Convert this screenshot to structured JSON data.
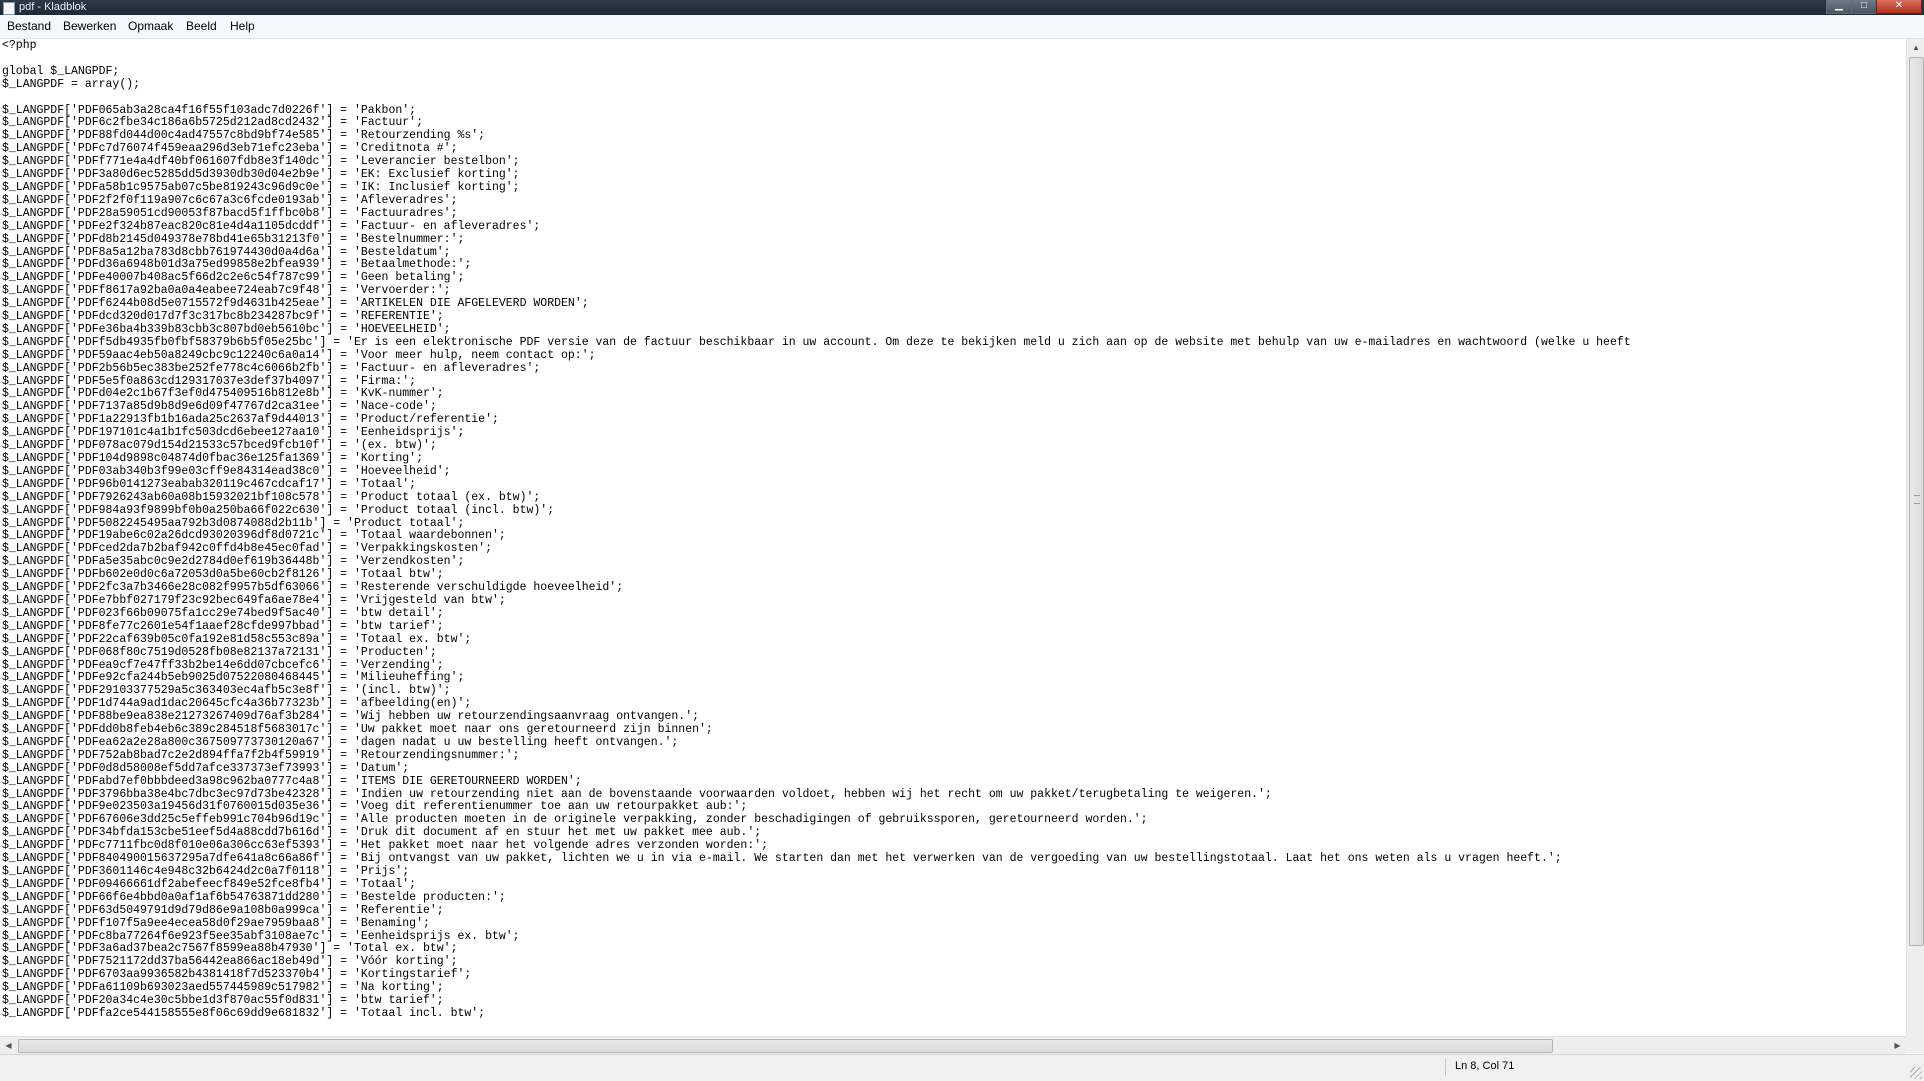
{
  "window": {
    "title": "pdf - Kladblok",
    "buttons": {
      "minimize": "▁",
      "maximize": "□",
      "close": "✕"
    }
  },
  "menu": [
    "Bestand",
    "Bewerken",
    "Opmaak",
    "Beeld",
    "Help"
  ],
  "editor": {
    "lines": [
      "<?php",
      "",
      "global $_LANGPDF;",
      "$_LANGPDF = array();",
      "",
      "$_LANGPDF['PDF065ab3a28ca4f16f55f103adc7d0226f'] = 'Pakbon';",
      "$_LANGPDF['PDF6c2fbe34c186a6b5725d212ad8cd2432'] = 'Factuur';",
      "$_LANGPDF['PDF88fd044d00c4ad47557c8bd9bf74e585'] = 'Retourzending %s';",
      "$_LANGPDF['PDFc7d76074f459eaa296d3eb71efc23eba'] = 'Creditnota #';",
      "$_LANGPDF['PDFf771e4a4df40bf061607fdb8e3f140dc'] = 'Leverancier bestelbon';",
      "$_LANGPDF['PDF3a80d6ec5285dd5d3930db30d04e2b9e'] = 'EK: Exclusief korting';",
      "$_LANGPDF['PDFa58b1c9575ab07c5be819243c96d9c0e'] = 'IK: Inclusief korting';",
      "$_LANGPDF['PDF2f2f0f119a907c6c67a3c6fcde0193ab'] = 'Afleveradres';",
      "$_LANGPDF['PDF28a59051cd90053f87bacd5f1ffbc0b8'] = 'Factuuradres';",
      "$_LANGPDF['PDFe2f324b87eac820c81e4d4a1105dcddf'] = 'Factuur- en afleveradres';",
      "$_LANGPDF['PDFd8b2145d049378e78bd41e65b31213f0'] = 'Bestelnummer:';",
      "$_LANGPDF['PDF8a5a12ba783d8cbb761974430d0a4d6a'] = 'Besteldatum';",
      "$_LANGPDF['PDFd36a6948b01d3a75ed99858e2bfea939'] = 'Betaalmethode:';",
      "$_LANGPDF['PDFe40007b408ac5f66d2c2e6c54f787c99'] = 'Geen betaling';",
      "$_LANGPDF['PDFf8617a92ba0a0a4eabee724eab7c9f48'] = 'Vervoerder:';",
      "$_LANGPDF['PDFf6244b08d5e0715572f9d4631b425eae'] = 'ARTIKELEN DIE AFGELEVERD WORDEN';",
      "$_LANGPDF['PDFdcd320d017d7f3c317bc8b234287bc9f'] = 'REFERENTIE';",
      "$_LANGPDF['PDFe36ba4b339b83cbb3c807bd0eb5610bc'] = 'HOEVEELHEID';",
      "$_LANGPDF['PDFf5db4935fb0fbf58379b6b5f05e25bc'] = 'Er is een elektronische PDF versie van de factuur beschikbaar in uw account. Om deze te bekijken meld u zich aan op de website met behulp van uw e-mailadres en wachtwoord (welke u heeft",
      "$_LANGPDF['PDF59aac4eb50a8249cbc9c12240c6a0a14'] = 'Voor meer hulp, neem contact op:';",
      "$_LANGPDF['PDF2b56b5ec383be252fe778c4c6066b2fb'] = 'Factuur- en afleveradres';",
      "$_LANGPDF['PDF5e5f0a863cd129317037e3def37b4097'] = 'Firma:';",
      "$_LANGPDF['PDFd04e2c1b67f3ef0d475409516b812e8b'] = 'KvK-nummer';",
      "$_LANGPDF['PDF7137a85d9b8d9e6d09f47767d2ca31ee'] = 'Nace-code';",
      "$_LANGPDF['PDF1a22913fb1b16ada25c2637af9d44013'] = 'Product/referentie';",
      "$_LANGPDF['PDF197101c4a1b1fc503dcd6ebee127aa10'] = 'Eenheidsprijs';",
      "$_LANGPDF['PDF078ac079d154d21533c57bced9fcb10f'] = '(ex. btw)';",
      "$_LANGPDF['PDF104d9898c04874d0fbac36e125fa1369'] = 'Korting';",
      "$_LANGPDF['PDF03ab340b3f99e03cff9e84314ead38c0'] = 'Hoeveelheid';",
      "$_LANGPDF['PDF96b0141273eabab320119c467cdcaf17'] = 'Totaal';",
      "$_LANGPDF['PDF7926243ab60a08b15932021bf108c578'] = 'Product totaal (ex. btw)';",
      "$_LANGPDF['PDF984a93f9899bf0b0a250ba66f022c630'] = 'Product totaal (incl. btw)';",
      "$_LANGPDF['PDF5082245495aa792b3d0874088d2b11b'] = 'Product totaal';",
      "$_LANGPDF['PDF19abe6c02a26dcd93020396df8d0721c'] = 'Totaal waardebonnen';",
      "$_LANGPDF['PDFced2da7b2baf942c0ffd4b8e45ec0fad'] = 'Verpakkingskosten';",
      "$_LANGPDF['PDFa5e35abc0c9e2d2784d0ef619b36448b'] = 'Verzendkosten';",
      "$_LANGPDF['PDFb602e0d0c6a72053d0a5be60cb2f8126'] = 'Totaal btw';",
      "$_LANGPDF['PDF2fc3a7b3466e28c082f9957b5df63066'] = 'Resterende verschuldigde hoeveelheid';",
      "$_LANGPDF['PDFe7bbf027179f23c92bec649fa6ae78e4'] = 'Vrijgesteld van btw';",
      "$_LANGPDF['PDF023f66b09075fa1cc29e74bed9f5ac40'] = 'btw detail';",
      "$_LANGPDF['PDF8fe77c2601e54f1aaef28cfde997bbad'] = 'btw tarief';",
      "$_LANGPDF['PDF22caf639b05c0fa192e81d58c553c89a'] = 'Totaal ex. btw';",
      "$_LANGPDF['PDF068f80c7519d0528fb08e82137a72131'] = 'Producten';",
      "$_LANGPDF['PDFea9cf7e47ff33b2be14e6dd07cbcefc6'] = 'Verzending';",
      "$_LANGPDF['PDFe92cfa244b5eb9025d07522080468445'] = 'Milieuheffing';",
      "$_LANGPDF['PDF29103377529a5c363403ec4afb5c3e8f'] = '(incl. btw)';",
      "$_LANGPDF['PDF1d744a9ad1dac20645cfc4a36b77323b'] = 'afbeelding(en)';",
      "$_LANGPDF['PDF88be9ea838e21273267409d76af3b284'] = 'Wij hebben uw retourzendingsaanvraag ontvangen.';",
      "$_LANGPDF['PDFdd0b8feb4eb6c389c284518f5683017c'] = 'Uw pakket moet naar ons geretourneerd zijn binnen';",
      "$_LANGPDF['PDFea62a2e28a800c367509773730120a67'] = 'dagen nadat u uw bestelling heeft ontvangen.';",
      "$_LANGPDF['PDF752ab8bad7c2e2d894ffa7f2b4f59919'] = 'Retourzendingsnummer:';",
      "$_LANGPDF['PDF0d8d58008ef5dd7afce337373ef73993'] = 'Datum';",
      "$_LANGPDF['PDFabd7ef0bbbdeed3a98c962ba0777c4a8'] = 'ITEMS DIE GERETOURNEERD WORDEN';",
      "$_LANGPDF['PDF3796bba38e4bc7dbc3ec97d73be42328'] = 'Indien uw retourzending niet aan de bovenstaande voorwaarden voldoet, hebben wij het recht om uw pakket/terugbetaling te weigeren.';",
      "$_LANGPDF['PDF9e023503a19456d31f0760015d035e36'] = 'Voeg dit referentienummer toe aan uw retourpakket aub:';",
      "$_LANGPDF['PDF67606e3dd25c5effeb991c704b96d19c'] = 'Alle producten moeten in de originele verpakking, zonder beschadigingen of gebruikssporen, geretourneerd worden.';",
      "$_LANGPDF['PDF34bfda153cbe51eef5d4a88cdd7b616d'] = 'Druk dit document af en stuur het met uw pakket mee aub.';",
      "$_LANGPDF['PDFc7711fbc0d8f010e06a306cc63ef5393'] = 'Het pakket moet naar het volgende adres verzonden worden:';",
      "$_LANGPDF['PDF840490015637295a7dfe641a8c66a86f'] = 'Bij ontvangst van uw pakket, lichten we u in via e-mail. We starten dan met het verwerken van de vergoeding van uw bestellingstotaal. Laat het ons weten als u vragen heeft.';",
      "$_LANGPDF['PDF3601146c4e948c32b6424d2c0a7f0118'] = 'Prijs';",
      "$_LANGPDF['PDF09466661df2abefeecf849e52fce8fb4'] = 'Totaal';",
      "$_LANGPDF['PDF66f6e4bbd0a0af1af6b54763871dd280'] = 'Bestelde producten:';",
      "$_LANGPDF['PDF63d5049791d9d79d86e9a108b0a999ca'] = 'Referentie';",
      "$_LANGPDF['PDFf107f5a9ee4ecea58d0f29ae7959baa8'] = 'Benaming';",
      "$_LANGPDF['PDFc8ba77264f6e923f5ee35abf3108ae7c'] = 'Eenheidsprijs ex. btw';",
      "$_LANGPDF['PDF3a6ad37bea2c7567f8599ea88b47930'] = 'Total ex. btw';",
      "$_LANGPDF['PDF7521172dd37ba56442ea866ac18eb49d'] = 'Vóór korting';",
      "$_LANGPDF['PDF6703aa9936582b4381418f7d523370b4'] = 'Kortingstarief';",
      "$_LANGPDF['PDFa61109b693023aed557445989c517982'] = 'Na korting';",
      "$_LANGPDF['PDF20a34c4e30c5bbe1d3f870ac55f0d831'] = 'btw tarief';",
      "$_LANGPDF['PDFfa2ce544158555e8f06c69dd9e681832'] = 'Totaal incl. btw';"
    ]
  },
  "statusbar": {
    "position": "Ln 8, Col 71"
  }
}
